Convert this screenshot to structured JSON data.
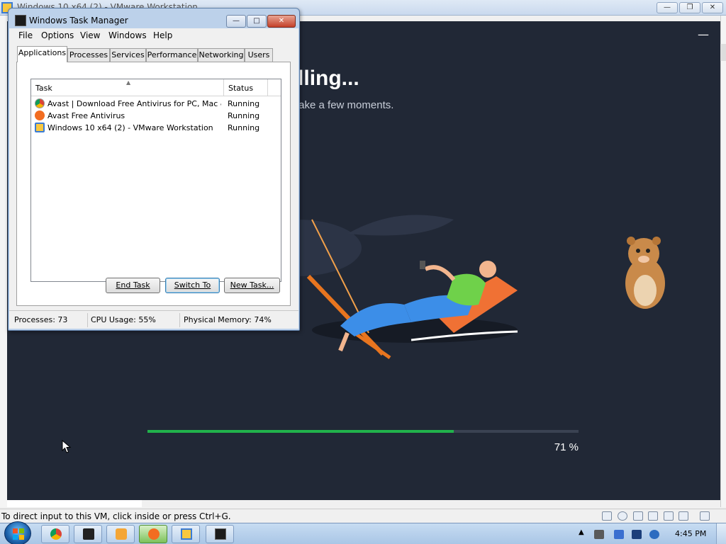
{
  "host_window": {
    "title": "Windows 10 x64 (2) - VMware Workstation",
    "controls": [
      "minimize",
      "restore",
      "close"
    ]
  },
  "installer": {
    "title": "Installing...",
    "subtitle": "This may take a few moments.",
    "progress_percent": 71,
    "progress_label": "71 %",
    "colors": {
      "background": "#212836",
      "progress": "#21b24b",
      "track": "#3a4252"
    }
  },
  "task_manager": {
    "title": "Windows Task Manager",
    "menu": [
      "File",
      "Options",
      "View",
      "Windows",
      "Help"
    ],
    "tabs": [
      "Applications",
      "Processes",
      "Services",
      "Performance",
      "Networking",
      "Users"
    ],
    "active_tab": "Applications",
    "columns": [
      "Task",
      "Status"
    ],
    "tasks": [
      {
        "name": "Avast | Download Free Antivirus for PC, Mac & ...",
        "status": "Running",
        "icon": "chrome-icon"
      },
      {
        "name": "Avast Free Antivirus",
        "status": "Running",
        "icon": "avast-icon"
      },
      {
        "name": "Windows 10 x64 (2) - VMware Workstation",
        "status": "Running",
        "icon": "vmware-icon"
      }
    ],
    "buttons": {
      "end_task": "End Task",
      "switch_to": "Switch To",
      "new_task": "New Task..."
    },
    "status_bar": {
      "processes": "Processes: 73",
      "cpu": "CPU Usage: 55%",
      "memory": "Physical Memory: 74%"
    }
  },
  "vm_status": {
    "text": "To direct input to this VM, click inside or press Ctrl+G."
  },
  "taskbar": {
    "buttons": [
      "chrome-icon",
      "terminal-icon",
      "media-player-icon",
      "avast-icon",
      "vmware-icon",
      "task-manager-icon"
    ],
    "active_button": "avast-icon",
    "clock": "4:45 PM"
  }
}
